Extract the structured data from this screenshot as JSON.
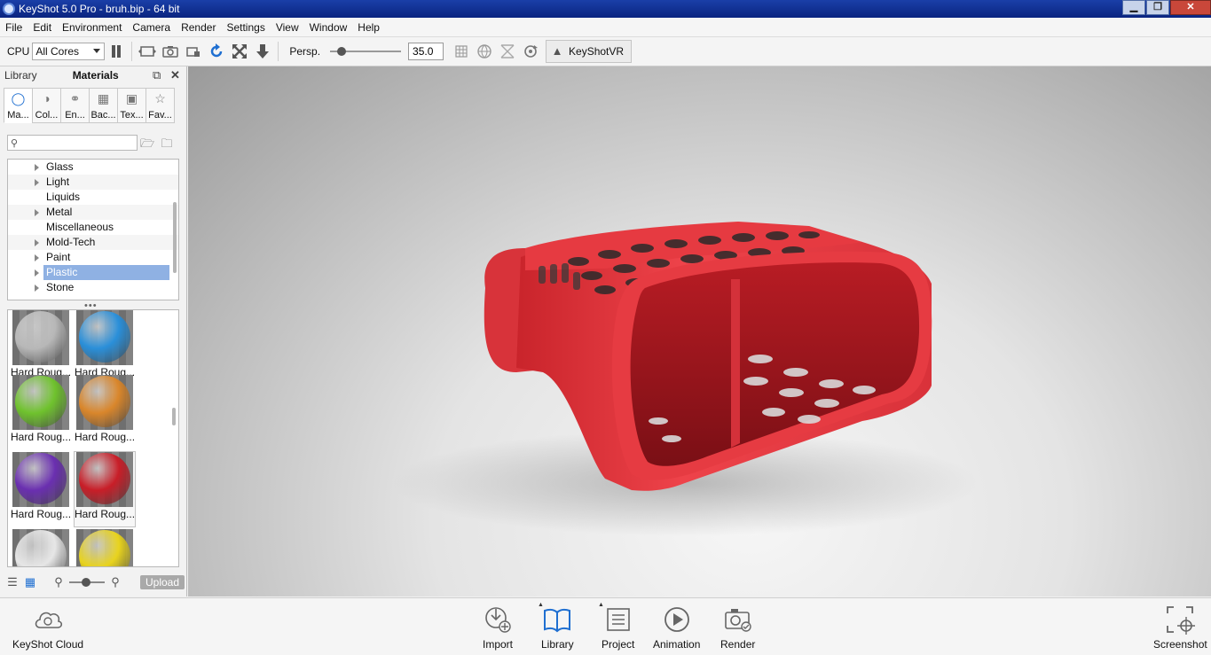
{
  "window": {
    "title": "KeyShot 5.0 Pro  - bruh.bip  - 64 bit",
    "minimize": "▁",
    "restore": "❐",
    "close": "✕"
  },
  "menu": [
    "File",
    "Edit",
    "Environment",
    "Camera",
    "Render",
    "Settings",
    "View",
    "Window",
    "Help"
  ],
  "toolbar": {
    "cpu_label": "CPU",
    "cpu_select": "All Cores",
    "persp_label": "Persp.",
    "fov_value": "35.0",
    "keyshotvr_label": "KeyShotVR"
  },
  "library": {
    "tab_library": "Library",
    "tab_materials": "Materials",
    "category_tabs": [
      "Ma...",
      "Col...",
      "En...",
      "Bac...",
      "Tex...",
      "Fav..."
    ],
    "search_placeholder": "",
    "tree": [
      {
        "label": "Glass",
        "expandable": true
      },
      {
        "label": "Light",
        "expandable": true
      },
      {
        "label": "Liquids",
        "expandable": false
      },
      {
        "label": "Metal",
        "expandable": true
      },
      {
        "label": "Miscellaneous",
        "expandable": false
      },
      {
        "label": "Mold-Tech",
        "expandable": true
      },
      {
        "label": "Paint",
        "expandable": true
      },
      {
        "label": "Plastic",
        "expandable": true,
        "selected": true
      },
      {
        "label": "Stone",
        "expandable": true
      }
    ],
    "materials": [
      {
        "name": "Hard Roug...",
        "color": "#b8b8b8"
      },
      {
        "name": "Hard Roug...",
        "color": "#2a8fd9"
      },
      {
        "name": "Hard Roug...",
        "color": "#6fc22d"
      },
      {
        "name": "Hard Roug...",
        "color": "#d9862b"
      },
      {
        "name": "Hard Roug...",
        "color": "#6a2fb0"
      },
      {
        "name": "Hard Roug...",
        "color": "#c81e28"
      },
      {
        "name": "",
        "color": "#e6e6e6"
      },
      {
        "name": "",
        "color": "#e8d31e"
      }
    ],
    "upload_label": "Upload"
  },
  "bottom": {
    "cloud": "KeyShot Cloud",
    "import": "Import",
    "library": "Library",
    "project": "Project",
    "animation": "Animation",
    "render": "Render",
    "screenshot": "Screenshot"
  },
  "colors": {
    "accent": "#1f6fd1",
    "model": "#e8393f",
    "selection": "#8fb1e3"
  }
}
